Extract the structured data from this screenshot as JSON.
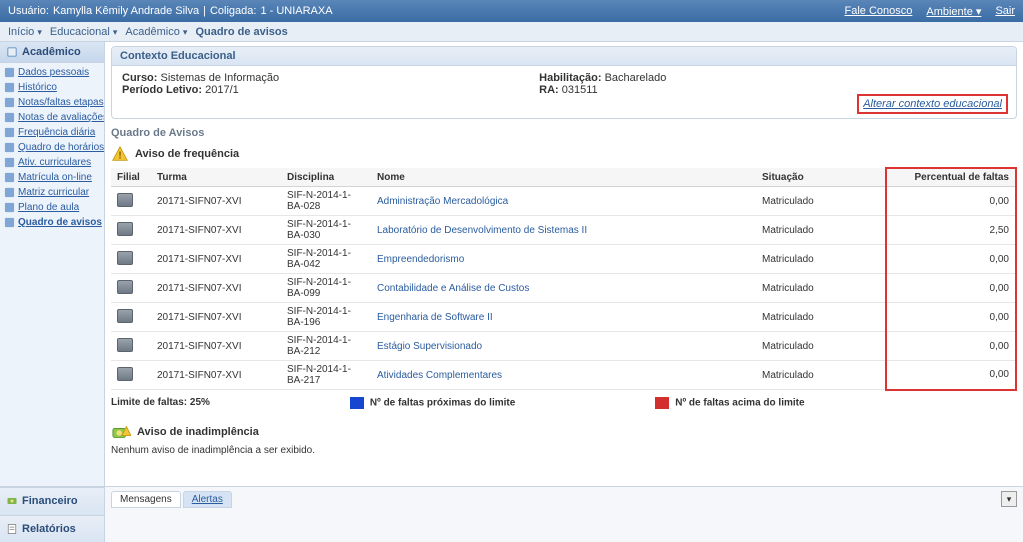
{
  "topbar": {
    "user_label": "Usuário:",
    "user_name": "Kamylla Kêmily Andrade Silva",
    "sep": " | ",
    "coligada_label": "Coligada:",
    "coligada_value": "1 - UNIARAXA",
    "fale_conosco": "Fale Conosco",
    "ambiente": "Ambiente",
    "sair": "Sair"
  },
  "breadcrumb": {
    "inicio": "Início",
    "educacional": "Educacional",
    "academico": "Acadêmico",
    "quadro": "Quadro de avisos"
  },
  "sidebar": {
    "header": "Acadêmico",
    "items": [
      {
        "label": "Dados pessoais"
      },
      {
        "label": "Histórico"
      },
      {
        "label": "Notas/faltas etapas"
      },
      {
        "label": "Notas de avaliações"
      },
      {
        "label": "Frequência diária"
      },
      {
        "label": "Quadro de horários"
      },
      {
        "label": "Ativ. curriculares"
      },
      {
        "label": "Matrícula on-line"
      },
      {
        "label": "Matriz curricular"
      },
      {
        "label": "Plano de aula"
      },
      {
        "label": "Quadro de avisos",
        "active": true
      }
    ]
  },
  "categories": {
    "financeiro": "Financeiro",
    "relatorios": "Relatórios"
  },
  "context": {
    "title": "Contexto Educacional",
    "curso_label": "Curso:",
    "curso_value": "Sistemas de Informação",
    "periodo_label": "Período Letivo:",
    "periodo_value": "2017/1",
    "habilitacao_label": "Habilitação:",
    "habilitacao_value": "Bacharelado",
    "ra_label": "RA:",
    "ra_value": "031511",
    "alterar_link": "Alterar contexto educacional"
  },
  "quadro_title": "Quadro de Avisos",
  "freq": {
    "title": "Aviso de frequência",
    "headers": {
      "filial": "Filial",
      "turma": "Turma",
      "disciplina": "Disciplina",
      "nome": "Nome",
      "situacao": "Situação",
      "percentual": "Percentual de faltas"
    },
    "rows": [
      {
        "turma": "20171-SIFN07-XVI",
        "disciplina": "SIF-N-2014-1-BA-028",
        "nome": "Administração Mercadológica",
        "situacao": "Matriculado",
        "perc": "0,00"
      },
      {
        "turma": "20171-SIFN07-XVI",
        "disciplina": "SIF-N-2014-1-BA-030",
        "nome": "Laboratório de Desenvolvimento de Sistemas II",
        "situacao": "Matriculado",
        "perc": "2,50"
      },
      {
        "turma": "20171-SIFN07-XVI",
        "disciplina": "SIF-N-2014-1-BA-042",
        "nome": "Empreendedorismo",
        "situacao": "Matriculado",
        "perc": "0,00"
      },
      {
        "turma": "20171-SIFN07-XVI",
        "disciplina": "SIF-N-2014-1-BA-099",
        "nome": "Contabilidade e Análise de Custos",
        "situacao": "Matriculado",
        "perc": "0,00"
      },
      {
        "turma": "20171-SIFN07-XVI",
        "disciplina": "SIF-N-2014-1-BA-196",
        "nome": "Engenharia de Software II",
        "situacao": "Matriculado",
        "perc": "0,00"
      },
      {
        "turma": "20171-SIFN07-XVI",
        "disciplina": "SIF-N-2014-1-BA-212",
        "nome": "Estágio Supervisionado",
        "situacao": "Matriculado",
        "perc": "0,00"
      },
      {
        "turma": "20171-SIFN07-XVI",
        "disciplina": "SIF-N-2014-1-BA-217",
        "nome": "Atividades Complementares",
        "situacao": "Matriculado",
        "perc": "0,00"
      }
    ],
    "limite_label": "Limite de faltas: 25%",
    "legend_near": "Nº de faltas próximas do limite",
    "legend_over": "Nº de faltas acima do limite"
  },
  "inad": {
    "title": "Aviso de inadimplência",
    "empty": "Nenhum aviso de inadimplência a ser exibido."
  },
  "tabs": {
    "mensagens": "Mensagens",
    "alertas": "Alertas"
  }
}
